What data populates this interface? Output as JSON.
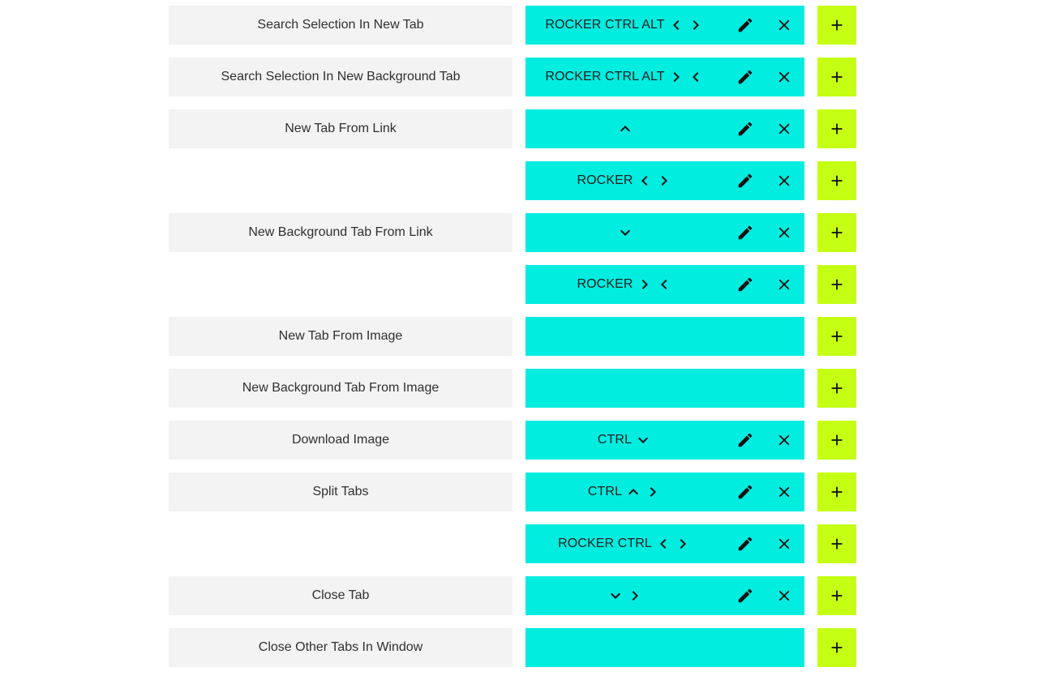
{
  "colors": {
    "label_bg": "#f3f3f3",
    "gesture_bg": "#00ede0",
    "add_bg": "#c4ff14",
    "text": "#202020"
  },
  "icons": {
    "edit": "pencil-icon",
    "remove": "close-icon",
    "add": "plus-icon",
    "directions": [
      "chevron-up-icon",
      "chevron-down-icon",
      "chevron-left-icon",
      "chevron-right-icon"
    ]
  },
  "rows": [
    {
      "label": "Search Selection In New Tab",
      "gesture": {
        "text": "ROCKER CTRL ALT",
        "dirs": [
          "left",
          "right"
        ]
      }
    },
    {
      "label": "Search Selection In New Background Tab",
      "gesture": {
        "text": "ROCKER CTRL ALT",
        "dirs": [
          "right",
          "left"
        ]
      }
    },
    {
      "label": "New Tab From Link",
      "gesture": {
        "text": "",
        "dirs": [
          "up"
        ]
      }
    },
    {
      "label": "",
      "gesture": {
        "text": "ROCKER",
        "dirs": [
          "left",
          "right"
        ]
      }
    },
    {
      "label": "New Background Tab From Link",
      "gesture": {
        "text": "",
        "dirs": [
          "down"
        ]
      }
    },
    {
      "label": "",
      "gesture": {
        "text": "ROCKER",
        "dirs": [
          "right",
          "left"
        ]
      }
    },
    {
      "label": "New Tab From Image",
      "gesture": null
    },
    {
      "label": "New Background Tab From Image",
      "gesture": null
    },
    {
      "label": "Download Image",
      "gesture": {
        "text": "CTRL",
        "dirs": [
          "down"
        ]
      }
    },
    {
      "label": "Split Tabs",
      "gesture": {
        "text": "CTRL",
        "dirs": [
          "up",
          "right"
        ]
      }
    },
    {
      "label": "",
      "gesture": {
        "text": "ROCKER CTRL",
        "dirs": [
          "left",
          "right"
        ]
      }
    },
    {
      "label": "Close Tab",
      "gesture": {
        "text": "",
        "dirs": [
          "down",
          "right"
        ]
      }
    },
    {
      "label": "Close Other Tabs In Window",
      "gesture": null
    }
  ]
}
